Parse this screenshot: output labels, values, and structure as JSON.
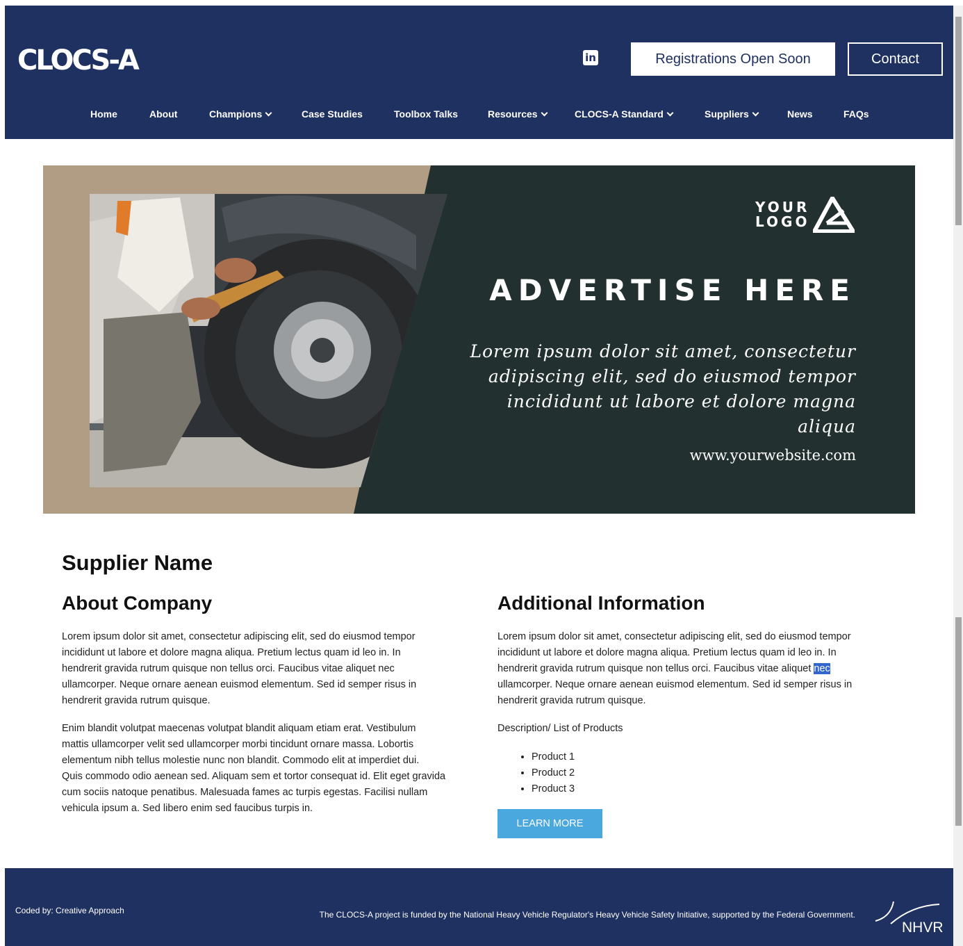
{
  "header": {
    "logo_text": "CLOCS-A",
    "linkedin_label": "in",
    "registrations_label": "Registrations Open Soon",
    "contact_label": "Contact"
  },
  "nav": {
    "items": [
      {
        "label": "Home",
        "dropdown": false
      },
      {
        "label": "About",
        "dropdown": false
      },
      {
        "label": "Champions",
        "dropdown": true
      },
      {
        "label": "Case Studies",
        "dropdown": false
      },
      {
        "label": "Toolbox Talks",
        "dropdown": false
      },
      {
        "label": "Resources",
        "dropdown": true
      },
      {
        "label": "CLOCS-A Standard",
        "dropdown": true
      },
      {
        "label": "Suppliers",
        "dropdown": true
      },
      {
        "label": "News",
        "dropdown": false
      },
      {
        "label": "FAQs",
        "dropdown": false
      }
    ]
  },
  "ad": {
    "logo_line1": "YOUR",
    "logo_line2": "LOGO",
    "title": "ADVERTISE HERE",
    "body_line1": "Lorem ipsum dolor sit amet, consectetur",
    "body_line2": "adipiscing elit, sed do eiusmod tempor",
    "body_line3": "incididunt ut labore et dolore magna aliqua",
    "url": "www.yourwebsite.com",
    "colors": {
      "tan": "#b19d83",
      "dark": "#22302f"
    }
  },
  "content": {
    "supplier_name": "Supplier Name",
    "about": {
      "heading": "About Company",
      "para1_lines": [
        "Lorem ipsum dolor sit amet, consectetur adipiscing elit, sed do eiusmod tempor",
        "incididunt ut labore et dolore magna aliqua. Pretium lectus quam id leo in. In",
        "hendrerit gravida rutrum quisque non tellus orci. Faucibus vitae aliquet nec",
        "ullamcorper. Neque ornare aenean euismod elementum. Sed id semper risus in",
        "hendrerit gravida rutrum quisque."
      ],
      "para2_lines": [
        "Enim blandit volutpat maecenas volutpat blandit aliquam etiam erat. Vestibulum",
        "mattis ullamcorper velit sed ullamcorper morbi tincidunt ornare massa. Lobortis",
        "elementum nibh tellus molestie nunc non blandit. Commodo elit at imperdiet dui.",
        "Quis commodo odio aenean sed. Aliquam sem et tortor consequat id. Elit eget gravida",
        "cum sociis natoque penatibus. Malesuada fames ac turpis egestas. Facilisi nullam",
        "vehicula ipsum a. Sed libero enim sed faucibus turpis in."
      ]
    },
    "additional": {
      "heading": "Additional Information",
      "para_line1": "Lorem ipsum dolor sit amet, consectetur adipiscing elit, sed do eiusmod tempor",
      "para_line2": "incididunt ut labore et dolore magna aliqua. Pretium lectus quam id leo in. In",
      "para_line3_pre": "hendrerit gravida rutrum quisque non tellus orci. Faucibus vitae aliquet ",
      "para_line3_selected": "nec",
      "para_line4": "ullamcorper. Neque ornare aenean euismod elementum. Sed id semper risus in",
      "para_line5": "hendrerit gravida rutrum quisque.",
      "description_label": "Description/ List of Products",
      "products": [
        "Product 1",
        "Product 2",
        "Product 3"
      ],
      "learn_more_label": "LEARN MORE"
    }
  },
  "footer": {
    "coded_by": "Coded by: Creative Approach",
    "funded_text": "The CLOCS-A project is funded by the National Heavy Vehicle Regulator's Heavy Vehicle Safety Initiative, supported by the Federal Government.",
    "nhvr_label": "NHVR"
  },
  "colors": {
    "navy": "#1f3160",
    "button_blue": "#4aa8de",
    "selection": "#3366cc"
  }
}
